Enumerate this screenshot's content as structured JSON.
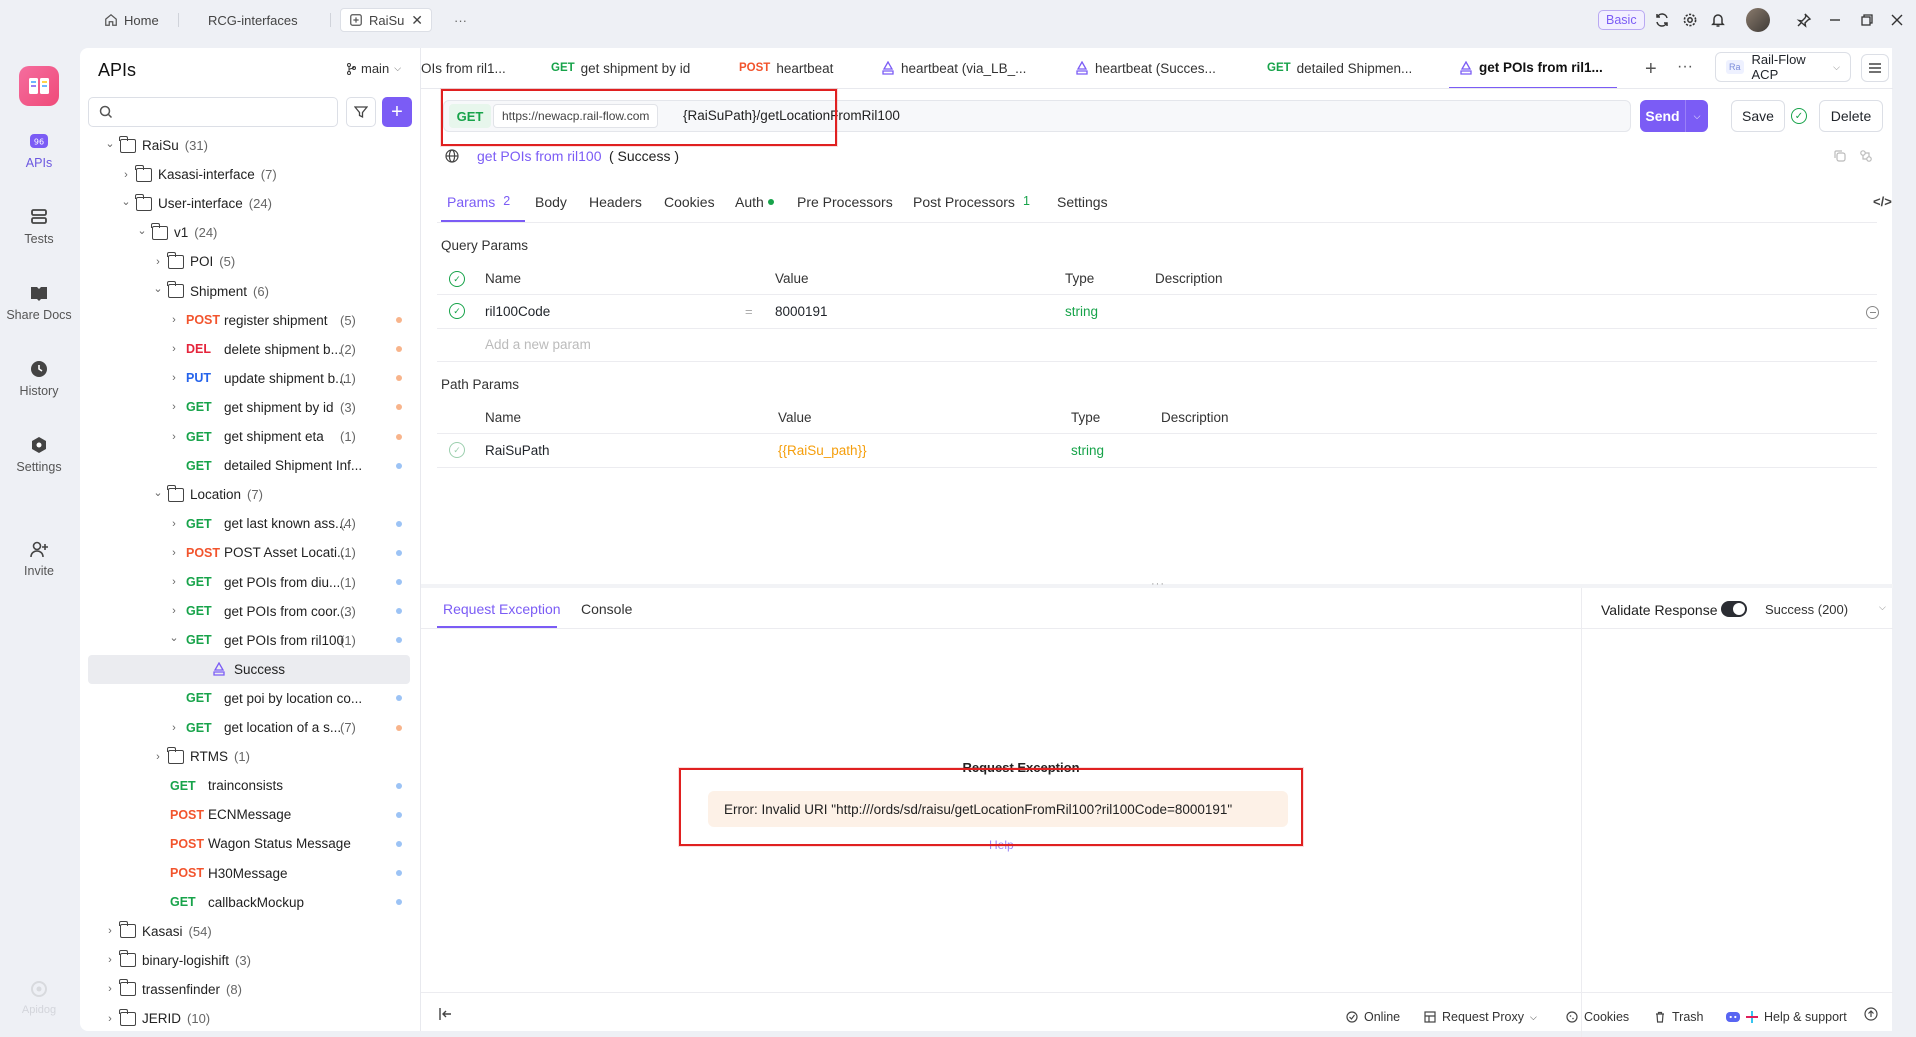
{
  "topbar": {
    "tabs": [
      {
        "label": "Home",
        "icon": "home-icon"
      },
      {
        "label": "RCG-interfaces"
      },
      {
        "label": "RaiSu",
        "icon": "doc-icon"
      }
    ],
    "more": "···",
    "plan_badge": "Basic"
  },
  "rail": {
    "items": [
      {
        "label": "APIs",
        "icon": "apis-icon"
      },
      {
        "label": "Tests",
        "icon": "tests-icon"
      },
      {
        "label": "Share Docs",
        "icon": "share-docs-icon"
      },
      {
        "label": "History",
        "icon": "history-icon"
      },
      {
        "label": "Settings",
        "icon": "settings-icon"
      },
      {
        "label": "Invite",
        "icon": "invite-icon"
      }
    ],
    "brand": "Apidog"
  },
  "sidebar": {
    "title": "APIs",
    "branch": "main",
    "search_placeholder": "",
    "tree": [
      {
        "label": "RaiSu",
        "count": "(31)",
        "kind": "folder",
        "chev": "v"
      },
      {
        "label": "Kasasi-interface",
        "count": "(7)",
        "kind": "folder",
        "chev": ">"
      },
      {
        "label": "User-interface",
        "count": "(24)",
        "kind": "folder",
        "chev": "v"
      },
      {
        "label": "v1",
        "count": "(24)",
        "kind": "folder",
        "chev": "v"
      },
      {
        "label": "POI",
        "count": "(5)",
        "kind": "folder",
        "chev": ">"
      },
      {
        "label": "Shipment",
        "count": "(6)",
        "kind": "folder",
        "chev": "v"
      },
      {
        "method": "POST",
        "label": "register shipment",
        "count": "(5)",
        "chev": ">"
      },
      {
        "method": "DEL",
        "label": "delete shipment b...",
        "count": "(2)",
        "chev": ">"
      },
      {
        "method": "PUT",
        "label": "update shipment b...",
        "count": "(1)",
        "chev": ">"
      },
      {
        "method": "GET",
        "label": "get shipment by id",
        "count": "(3)",
        "chev": ">"
      },
      {
        "method": "GET",
        "label": "get shipment eta",
        "count": "(1)",
        "chev": ">"
      },
      {
        "method": "GET",
        "label": "detailed Shipment Inf...",
        "count": "",
        "chev": ""
      },
      {
        "label": "Location",
        "count": "(7)",
        "kind": "folder",
        "chev": "v"
      },
      {
        "method": "GET",
        "label": "get last known ass...",
        "count": "(4)",
        "chev": ">"
      },
      {
        "method": "POST",
        "label": "POST Asset Locati...",
        "count": "(1)",
        "chev": ">"
      },
      {
        "method": "GET",
        "label": "get POIs from diu...",
        "count": "(1)",
        "chev": ">"
      },
      {
        "method": "GET",
        "label": "get POIs from coor...",
        "count": "(3)",
        "chev": ">"
      },
      {
        "method": "GET",
        "label": "get POIs from ril100",
        "count": "(1)",
        "chev": "v"
      },
      {
        "label": "Success",
        "kind": "example"
      },
      {
        "method": "GET",
        "label": "get poi by location co...",
        "count": "",
        "chev": ""
      },
      {
        "method": "GET",
        "label": "get location of a s...",
        "count": "(7)",
        "chev": ">"
      },
      {
        "label": "RTMS",
        "count": "(1)",
        "kind": "folder",
        "chev": ">"
      },
      {
        "method": "GET",
        "label": "trainconsists",
        "count": "",
        "chev": ""
      },
      {
        "method": "POST",
        "label": "ECNMessage",
        "count": "",
        "chev": ""
      },
      {
        "method": "POST",
        "label": "Wagon Status Message",
        "count": "",
        "chev": ""
      },
      {
        "method": "POST",
        "label": "H30Message",
        "count": "",
        "chev": ""
      },
      {
        "method": "GET",
        "label": "callbackMockup",
        "count": "",
        "chev": ""
      },
      {
        "label": "Kasasi",
        "count": "(54)",
        "kind": "folder",
        "chev": ">"
      },
      {
        "label": "binary-logishift",
        "count": "(3)",
        "kind": "folder",
        "chev": ">"
      },
      {
        "label": "trassenfinder",
        "count": "(8)",
        "kind": "folder",
        "chev": ">"
      },
      {
        "label": "JERID",
        "count": "(10)",
        "kind": "folder",
        "chev": ">"
      }
    ]
  },
  "request_tabs": [
    {
      "method": "",
      "label": "OIs from ril1..."
    },
    {
      "method": "GET",
      "label": "get shipment by id"
    },
    {
      "method": "POST",
      "label": "heartbeat"
    },
    {
      "method": "",
      "label": "heartbeat (via_LB_...",
      "icon": "example-icon"
    },
    {
      "method": "",
      "label": "heartbeat (Succes...",
      "icon": "example-icon"
    },
    {
      "method": "GET",
      "label": "detailed Shipmen..."
    },
    {
      "method": "",
      "label": "get POIs from ril1...",
      "icon": "example-icon"
    }
  ],
  "environment": {
    "badge": "Ra",
    "name": "Rail-Flow ACP"
  },
  "request": {
    "method": "GET",
    "base_url": "https://newacp.rail-flow.com",
    "path": "{RaiSuPath}/getLocationFromRil100",
    "send": "Send",
    "save": "Save",
    "delete": "Delete",
    "name": "get POIs from ril100",
    "example": "( Success )"
  },
  "param_tabs": [
    {
      "label": "Params",
      "badge": "2"
    },
    {
      "label": "Body"
    },
    {
      "label": "Headers"
    },
    {
      "label": "Cookies"
    },
    {
      "label": "Auth"
    },
    {
      "label": "Pre Processors"
    },
    {
      "label": "Post Processors",
      "badge": "1"
    },
    {
      "label": "Settings"
    }
  ],
  "query_params": {
    "title": "Query Params",
    "headers": [
      "Name",
      "Value",
      "Type",
      "Description"
    ],
    "rows": [
      {
        "name": "ril100Code",
        "eq": "=",
        "value": "8000191",
        "type": "string",
        "description": ""
      }
    ],
    "add_placeholder": "Add a new param"
  },
  "path_params": {
    "title": "Path Params",
    "headers": [
      "Name",
      "Value",
      "Type",
      "Description"
    ],
    "rows": [
      {
        "name": "RaiSuPath",
        "value": "{{RaiSu_path}}",
        "type": "string",
        "description": ""
      }
    ]
  },
  "response": {
    "tabs": [
      "Request Exception",
      "Console"
    ],
    "validate_label": "Validate Response",
    "status": "Success (200)",
    "exception_title": "Request Exception",
    "error": "Error: Invalid URI \"http:///ords/sd/raisu/getLocationFromRil100?ril100Code=8000191\"",
    "help": "Help"
  },
  "statusbar": {
    "online": "Online",
    "proxy": "Request Proxy",
    "cookies": "Cookies",
    "trash": "Trash",
    "help": "Help & support"
  },
  "colors": {
    "accent": "#7b5cf5",
    "get": "#17a34a",
    "post": "#f2542d",
    "del": "#e5243b",
    "put": "#2563eb",
    "highlight": "#e02020"
  }
}
